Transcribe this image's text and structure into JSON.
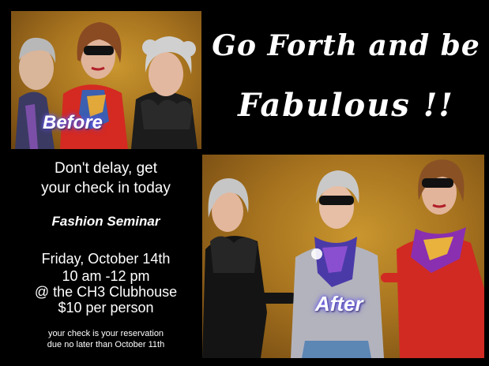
{
  "headline": {
    "line1": "Go Forth and be",
    "line2": "Fabulous !!"
  },
  "photos": {
    "before_caption": "Before",
    "after_caption": "After"
  },
  "call_to_action": {
    "line1": "Don't delay, get",
    "line2": "your check in today"
  },
  "event": {
    "name": "Fashion Seminar",
    "date": "Friday, October 14th",
    "time": "10 am -12 pm",
    "location": "@ the  CH3 Clubhouse",
    "price": "$10  per person"
  },
  "note": {
    "line1": "your check is your reservation",
    "line2": "due no later than October 11th"
  },
  "colors": {
    "background": "#000000",
    "text": "#ffffff",
    "photo_backdrop": "#b07b22",
    "caption_glow": "#6a5cff"
  }
}
